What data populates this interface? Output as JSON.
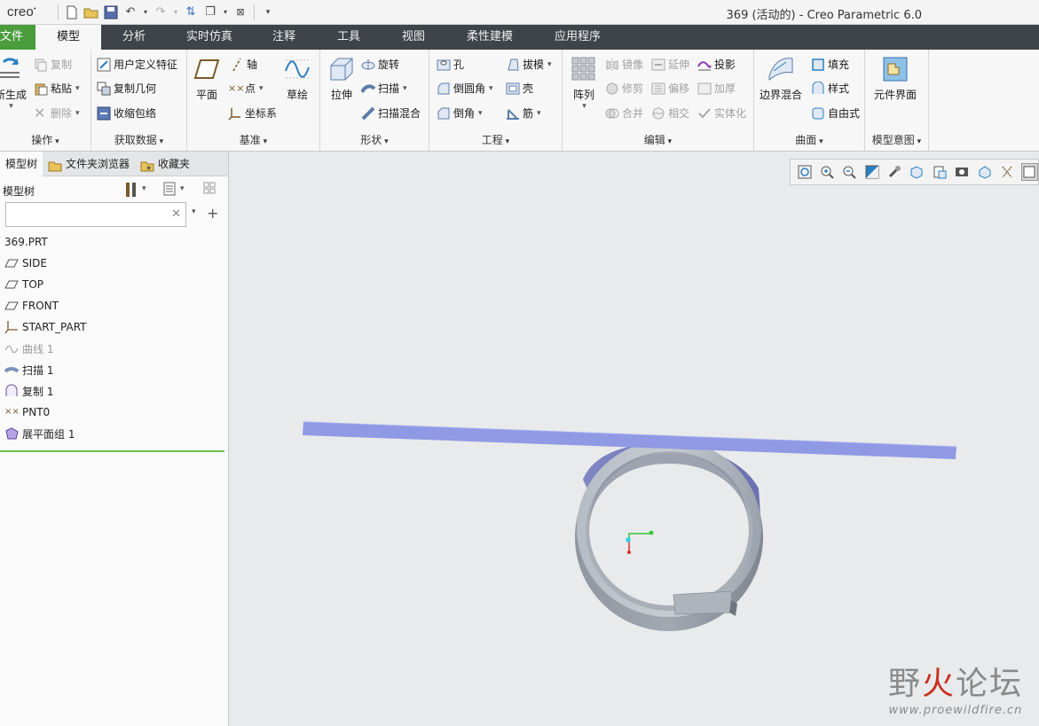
{
  "app": {
    "logo": "creo",
    "window_title": "369 (活动的) - Creo Parametric 6.0"
  },
  "tabs": [
    "文件",
    "模型",
    "分析",
    "实时仿真",
    "注释",
    "工具",
    "视图",
    "柔性建模",
    "应用程序"
  ],
  "ribbon": {
    "operations": {
      "regenerate": "新生成",
      "copy": "复制",
      "paste": "粘贴",
      "delete": "删除",
      "label": "操作"
    },
    "get_data": {
      "udf": "用户定义特征",
      "copy_geom": "复制几何",
      "shrinkwrap": "收缩包络",
      "label": "获取数据"
    },
    "datum": {
      "plane": "平面",
      "axis": "轴",
      "point": "点",
      "csys": "坐标系",
      "sketch": "草绘",
      "label": "基准"
    },
    "shapes": {
      "extrude": "拉伸",
      "revolve": "旋转",
      "sweep": "扫描",
      "swept_blend": "扫描混合",
      "label": "形状"
    },
    "engineering": {
      "hole": "孔",
      "round": "倒圆角",
      "chamfer": "倒角",
      "draft": "拔模",
      "shell": "壳",
      "rib": "筋",
      "label": "工程"
    },
    "editing": {
      "pattern": "阵列",
      "mirror": "镜像",
      "trim": "修剪",
      "merge": "合并",
      "extend": "延伸",
      "offset": "偏移",
      "intersect": "相交",
      "project": "投影",
      "thicken": "加厚",
      "solidify": "实体化",
      "label": "编辑"
    },
    "surfaces": {
      "boundary_blend": "边界混合",
      "fill": "填充",
      "style": "样式",
      "freestyle": "自由式",
      "label": "曲面"
    },
    "model_intent": {
      "component_interface": "元件界面",
      "label": "模型意图"
    }
  },
  "panel": {
    "tabs": [
      "模型树",
      "文件夹浏览器",
      "收藏夹"
    ],
    "tree_title": "模型树",
    "search_placeholder": "",
    "items": [
      {
        "label": "369.PRT",
        "icon": "part-icon"
      },
      {
        "label": "SIDE",
        "icon": "datum-plane-icon"
      },
      {
        "label": "TOP",
        "icon": "datum-plane-icon"
      },
      {
        "label": "FRONT",
        "icon": "datum-plane-icon"
      },
      {
        "label": "START_PART",
        "icon": "csys-icon"
      },
      {
        "label": "曲线 1",
        "icon": "curve-icon"
      },
      {
        "label": "扫描 1",
        "icon": "sweep-icon"
      },
      {
        "label": "复制 1",
        "icon": "copy-surface-icon"
      },
      {
        "label": "PNT0",
        "icon": "datum-point-icon"
      },
      {
        "label": "展平面组 1",
        "icon": "flatten-quilt-icon"
      }
    ]
  },
  "watermark": {
    "main_black": "野",
    "main_red": "火",
    "main_rest": "论坛",
    "url": "www.proewildfire.cn"
  },
  "colors": {
    "tab_bar": "#3e4449",
    "file_tab": "#4a9c3d",
    "flat_band": "#8f99e4",
    "ring": "#9aa0a8",
    "tree_line": "#6cc04a"
  }
}
